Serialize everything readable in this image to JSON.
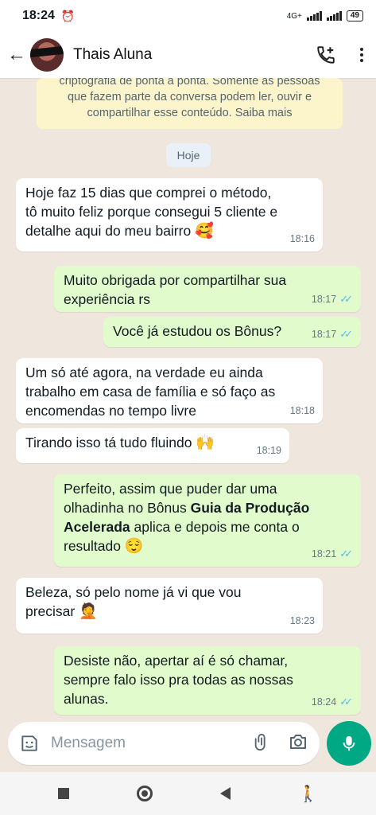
{
  "status_bar": {
    "time": "18:24",
    "network": "4G+",
    "battery": "49"
  },
  "header": {
    "contact_name": "Thais Aluna"
  },
  "encryption_notice": {
    "lines": [
      "criptografia de ponta a ponta. Somente as pessoas",
      "que fazem parte da conversa podem ler, ouvir e",
      "compartilhar esse conteúdo. Saiba mais"
    ]
  },
  "date_chip": "Hoje",
  "messages": [
    {
      "direction": "in",
      "lines": [
        "Hoje faz 15 dias que comprei o método,",
        "tô muito feliz porque consegui 5 cliente e",
        "detalhe aqui do meu bairro"
      ],
      "emoji": "🥰",
      "time": "18:16"
    },
    {
      "direction": "out",
      "lines": [
        "Muito obrigada por compartilhar sua",
        "experiência rs"
      ],
      "time": "18:17"
    },
    {
      "direction": "out",
      "lines": [
        "Você já estudou os Bônus?"
      ],
      "time": "18:17"
    },
    {
      "direction": "in",
      "lines": [
        "Um só até agora, na verdade eu ainda",
        "trabalho em casa de família e só faço as",
        "encomendas no tempo livre"
      ],
      "time": "18:18"
    },
    {
      "direction": "in",
      "lines": [
        "Tirando isso tá tudo fluindo"
      ],
      "emoji": "🙌",
      "time": "18:19"
    },
    {
      "direction": "out",
      "line1": "Perfeito, assim que puder dar uma",
      "line2_pre": "olhadinha no Bônus  ",
      "line2_bold": "Guia da Produção",
      "line3_bold": "Acelerada",
      "line3_post": " aplica e depois me conta o",
      "line4": "resultado",
      "emoji": "😌",
      "time": "18:21"
    },
    {
      "direction": "in",
      "lines": [
        "Beleza, só pelo nome já vi que vou",
        "precisar"
      ],
      "emoji": "🤦",
      "time": "18:23"
    },
    {
      "direction": "out",
      "lines": [
        "Desiste não, apertar aí é só chamar,",
        "sempre falo isso pra todas as nossas",
        "alunas."
      ],
      "time": "18:24"
    }
  ],
  "composer": {
    "placeholder": "Mensagem"
  },
  "colors": {
    "outgoing_bubble": "#e2fbcc",
    "incoming_bubble": "#ffffff",
    "read_ticks": "#53bdeb",
    "mic_button": "#00a884",
    "encryption_bg": "#fcf4cb"
  }
}
